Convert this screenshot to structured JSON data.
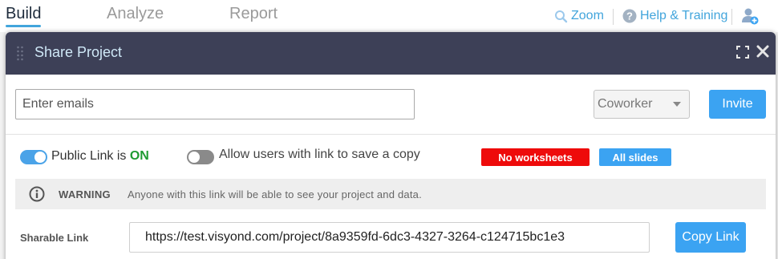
{
  "nav": {
    "tabs": [
      {
        "label": "Build",
        "active": true
      },
      {
        "label": "Analyze",
        "active": false
      },
      {
        "label": "Report",
        "active": false
      }
    ],
    "actions": {
      "zoom_label": "Zoom",
      "help_label": "Help & Training",
      "zoom_icon": "magnifier-icon",
      "help_icon": "question-circle-icon",
      "user_icon": "add-user-icon"
    }
  },
  "modal": {
    "title": "Share Project",
    "invite": {
      "email_placeholder": "Enter emails",
      "email_value": "",
      "role_selected": "Coworker",
      "invite_label": "Invite"
    },
    "options": {
      "public_link_prefix": "Public Link is ",
      "public_link_state": "ON",
      "public_link_on": true,
      "save_copy_label": "Allow users with link to save a copy",
      "save_copy_on": false,
      "badge_worksheets": "No worksheets",
      "badge_slides": "All slides"
    },
    "warning": {
      "title": "WARNING",
      "text": "Anyone with this link will be able to see your project and data."
    },
    "share": {
      "label": "Sharable Link",
      "url": "https://test.visyond.com/project/8a9359fd-6dc3-4327-3264-c124715bc1e3",
      "copy_label": "Copy Link"
    }
  },
  "colors": {
    "accent": "#3ba3f2",
    "header_bg": "#3d4057",
    "on_green": "#1f9b32",
    "badge_red": "#ee0b0b"
  }
}
